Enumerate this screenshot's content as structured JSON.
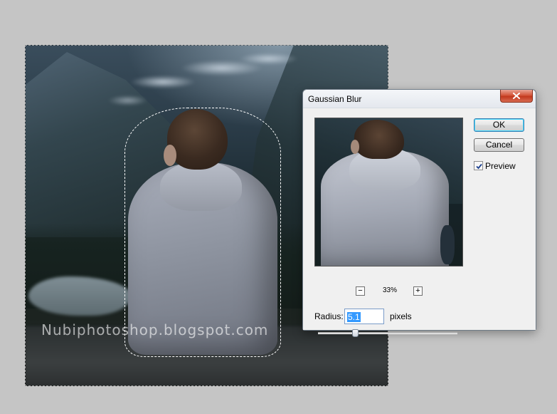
{
  "canvas": {
    "watermark": "Nubiphotoshop.blogspot.com"
  },
  "dialog": {
    "title": "Gaussian Blur",
    "close_icon": "close-icon",
    "ok_label": "OK",
    "cancel_label": "Cancel",
    "preview_label": "Preview",
    "preview_checked": true,
    "zoom_minus": "−",
    "zoom_plus": "+",
    "zoom_level": "33%",
    "radius_label": "Radius:",
    "radius_value": "5.1",
    "radius_unit": "pixels",
    "radius_slider_fraction": 0.27
  },
  "colors": {
    "canvas_bg": "#c5c5c5",
    "dialog_bg": "#f0f0f0",
    "close_button": "#c9452a",
    "ok_focus_ring": "#48d8fb",
    "selection_highlight": "#3399ff"
  }
}
